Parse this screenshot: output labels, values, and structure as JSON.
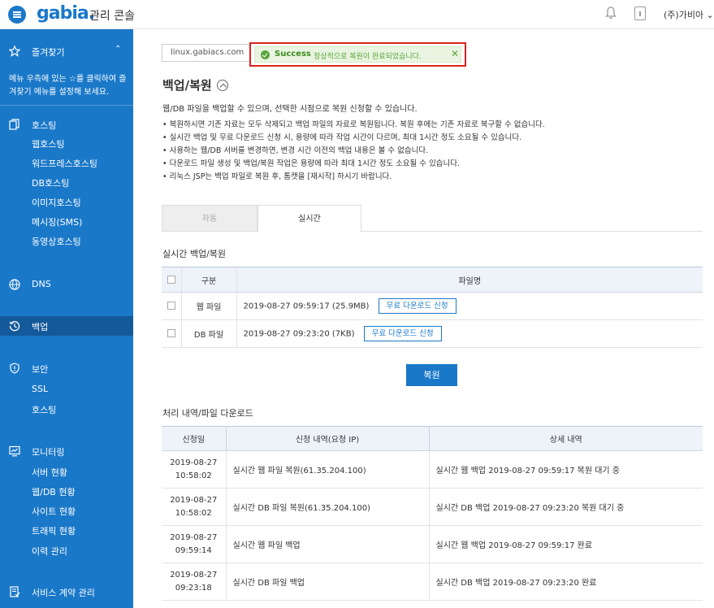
{
  "header": {
    "logo": "gabia.",
    "title": "관리 콘솔",
    "user": "(주)가비아 ⌄"
  },
  "sidebar": {
    "favorites": "즐겨찾기",
    "favorites_note": "메뉴 우측에 있는 ☆를 클릭하여 즐겨찾기 메뉴를 설정해 보세요.",
    "hosting": "호스팅",
    "hosting_items": [
      "웹호스팅",
      "워드프레스호스팅",
      "DB호스팅",
      "이미지호스팅",
      "메시징(SMS)",
      "동영상호스팅"
    ],
    "dns": "DNS",
    "backup": "백업",
    "security": "보안",
    "security_items": [
      "SSL",
      "호스팅"
    ],
    "monitoring": "모니터링",
    "monitoring_items": [
      "서버 현황",
      "웹/DB 현황",
      "사이트 현황",
      "트래픽 현황",
      "이력 관리"
    ],
    "contract": "서비스 계약 관리"
  },
  "main": {
    "host": "linux.gabiacs.com",
    "alert_title": "Success",
    "alert_text": "정상적으로 복원이 완료되었습니다.",
    "title": "백업/복원",
    "intro": "웹/DB 파일을 백업할 수 있으며, 선택한 시점으로 복원 신청할 수 있습니다.",
    "bullets": [
      "복원하시면 기존 자료는 모두 삭제되고 백업 파일의 자료로 복원됩니다. 복원 후에는 기존 자료로 복구할 수 없습니다.",
      "실시간 백업 및 무료 다운로드 신청 시, 용량에 따라 작업 시간이 다르며, 최대 1시간 정도 소요될 수 있습니다.",
      "사용하는 웹/DB 서버를 변경하면, 변경 시간 이전의 백업 내용은 볼 수 없습니다.",
      "다운로드 파일 생성 및 백업/복원 작업은 용량에 따라 최대 1시간 정도 소요될 수 있습니다.",
      "리눅스 JSP는 백업 파일로 복원 후, 톰캣을 [재시작] 하시기 바랍니다."
    ],
    "tab_auto": "자동",
    "tab_realtime": "실시간",
    "section1": "실시간 백업/복원",
    "t1_headers": [
      "구분",
      "파일명"
    ],
    "t1_rows": [
      {
        "type": "웹 파일",
        "file": "2019-08-27 09:59:17 (25.9MB)",
        "btn": "무료 다운로드 신청"
      },
      {
        "type": "DB 파일",
        "file": "2019-08-27 09:23:20 (7KB)",
        "btn": "무료 다운로드 신청"
      }
    ],
    "restore_btn": "복원",
    "section2": "처리 내역/파일 다운로드",
    "t2_headers": [
      "신청일",
      "신청 내역(요청 IP)",
      "상세 내역"
    ],
    "t2_rows": [
      {
        "date": "2019-08-27",
        "time": "10:58:02",
        "req": "실시간 웹 파일 복원(61.35.204.100)",
        "detail": "실시간 웹 백업 2019-08-27 09:59:17 복원 대기 중"
      },
      {
        "date": "2019-08-27",
        "time": "10:58:02",
        "req": "실시간 DB 파일 복원(61.35.204.100)",
        "detail": "실시간 DB 백업 2019-08-27 09:23:20 복원 대기 중"
      },
      {
        "date": "2019-08-27",
        "time": "09:59:14",
        "req": "실시간 웹 파일 백업",
        "detail": "실시간 웹 백업 2019-08-27 09:59:17 완료"
      },
      {
        "date": "2019-08-27",
        "time": "09:23:18",
        "req": "실시간 DB 파일 백업",
        "detail": "실시간 DB 백업 2019-08-27 09:23:20 완료"
      }
    ]
  },
  "colors": {
    "brand": "#1a78c8",
    "alert_border": "#d9231f",
    "success": "#5aa53a"
  }
}
